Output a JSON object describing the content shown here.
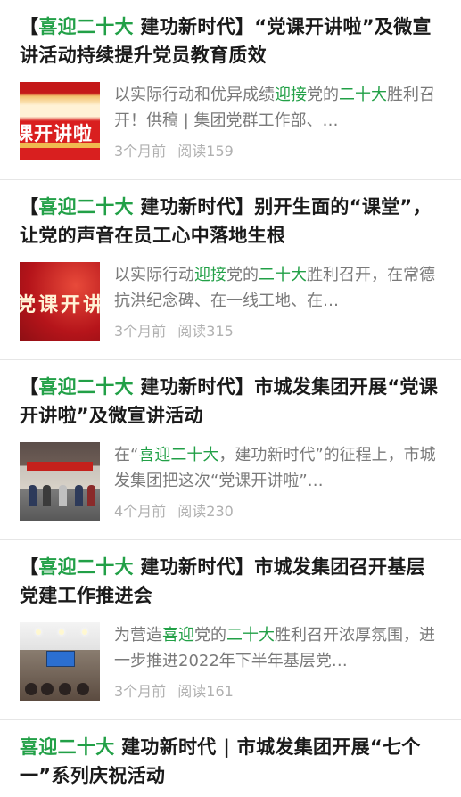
{
  "articles": [
    {
      "title_prefix": "【",
      "title_hl": "喜迎二十大",
      "title_rest": " 建功新时代】“党课开讲啦”及微宣讲活动持续提升党员教育质效",
      "snippet": [
        {
          "t": "以实际行动和优异成绩",
          "hl": false
        },
        {
          "t": "迎接",
          "hl": true
        },
        {
          "t": "党的",
          "hl": false
        },
        {
          "t": "二十大",
          "hl": true
        },
        {
          "t": "胜利召开！供稿 | 集团党群工作部、…",
          "hl": false
        }
      ],
      "time": "3个月前",
      "reads": "阅读159",
      "thumb_text": "课开讲啦"
    },
    {
      "title_prefix": "【",
      "title_hl": "喜迎二十大",
      "title_rest": " 建功新时代】别开生面的“课堂”，让党的声音在员工心中落地生根",
      "snippet": [
        {
          "t": "以实际行动",
          "hl": false
        },
        {
          "t": "迎接",
          "hl": true
        },
        {
          "t": "党的",
          "hl": false
        },
        {
          "t": "二十大",
          "hl": true
        },
        {
          "t": "胜利召开，在常德抗洪纪念碑、在一线工地、在…",
          "hl": false
        }
      ],
      "time": "3个月前",
      "reads": "阅读315",
      "thumb_text": "党课开讲"
    },
    {
      "title_prefix": "【",
      "title_hl": "喜迎二十大",
      "title_rest": " 建功新时代】市城发集团开展“党课开讲啦”及微宣讲活动",
      "snippet": [
        {
          "t": "在“",
          "hl": false
        },
        {
          "t": "喜迎二十大",
          "hl": true
        },
        {
          "t": "，建功新时代”的征程上，市城发集团把这次“党课开讲啦”…",
          "hl": false
        }
      ],
      "time": "4个月前",
      "reads": "阅读230"
    },
    {
      "title_prefix": "【",
      "title_hl": "喜迎二十大",
      "title_rest": " 建功新时代】市城发集团召开基层党建工作推进会",
      "snippet": [
        {
          "t": "为营造",
          "hl": false
        },
        {
          "t": "喜迎",
          "hl": true
        },
        {
          "t": "党的",
          "hl": false
        },
        {
          "t": "二十大",
          "hl": true
        },
        {
          "t": "胜利召开浓厚氛围，进一步推进2022年下半年基层党…",
          "hl": false
        }
      ],
      "time": "3个月前",
      "reads": "阅读161"
    },
    {
      "title_prefix": "",
      "title_hl": "喜迎二十大",
      "title_rest": " 建功新时代 | 市城发集团开展“七个一”系列庆祝活动"
    }
  ],
  "colors": {
    "highlight": "#22a047",
    "meta": "#b0b0b0",
    "snippet": "#7a7a7a"
  }
}
